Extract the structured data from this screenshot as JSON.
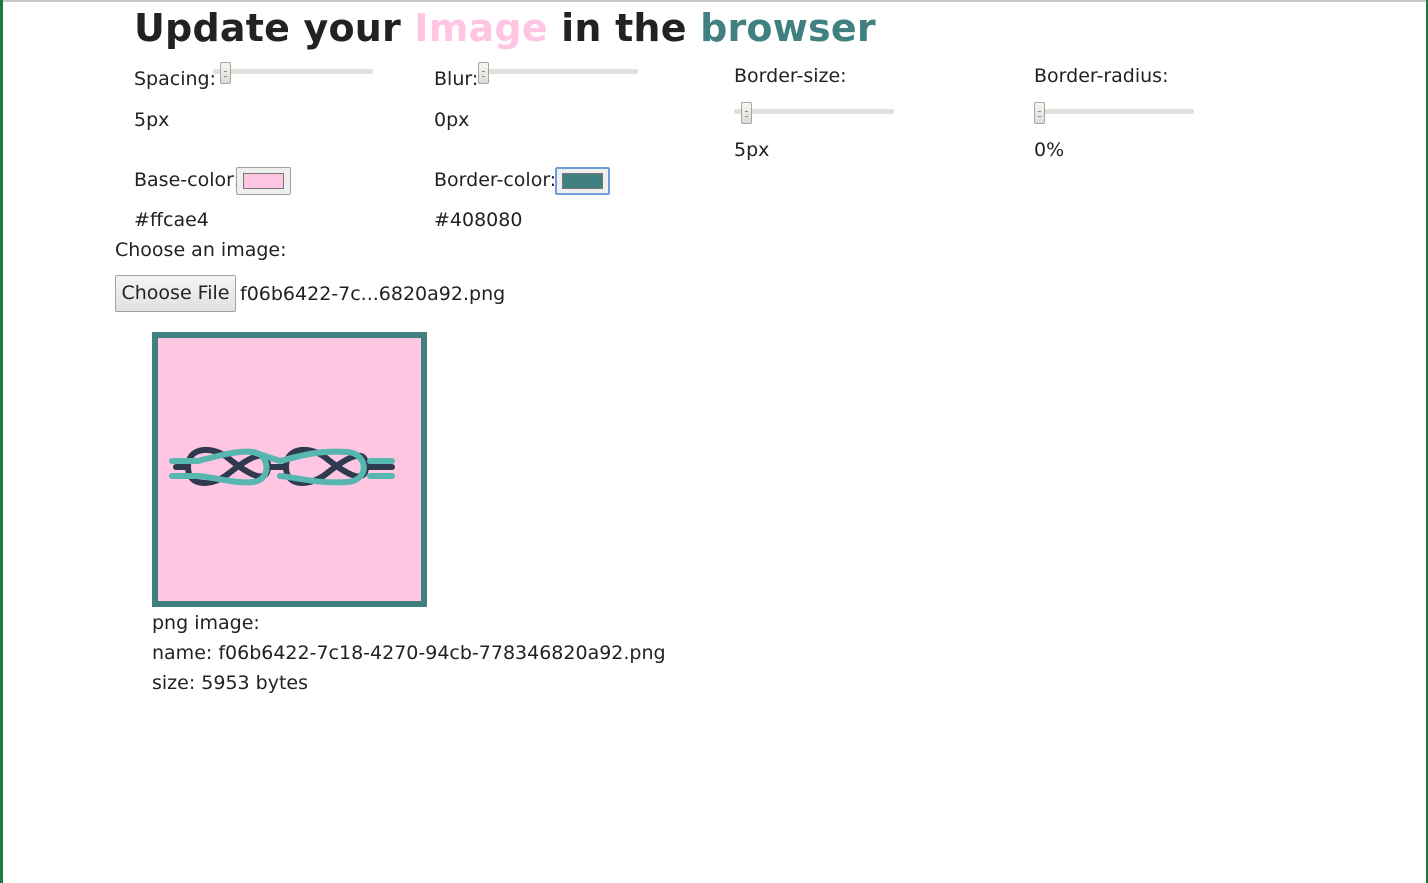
{
  "title": {
    "part1": "Update your ",
    "part2": "Image",
    "part3": " in the ",
    "part4": "browser"
  },
  "controls": {
    "spacing": {
      "label": "Spacing:",
      "value": "5px",
      "level": 0.05
    },
    "blur": {
      "label": "Blur:",
      "value": "0px",
      "level": 0.0
    },
    "border_size": {
      "label": "Border-size:",
      "value": "5px",
      "level": 0.05
    },
    "border_radius": {
      "label": "Border-radius:",
      "value": "0%",
      "level": 0.0
    },
    "base_color": {
      "label": "Base-color:",
      "value": "#ffcae4",
      "swatch": "#ffc6e4"
    },
    "border_color": {
      "label": "Border-color:",
      "value": "#408080",
      "swatch": "#408080"
    }
  },
  "file": {
    "label": "Choose an image:",
    "button": "Choose File",
    "filename": "f06b6422-7c...6820a92.png"
  },
  "preview": {
    "icon": "knot-rope-icon",
    "info": {
      "type": "png image:",
      "name": "name: f06b6422-7c18-4270-94cb-778346820a92.png",
      "size": "size: 5953 bytes"
    }
  }
}
